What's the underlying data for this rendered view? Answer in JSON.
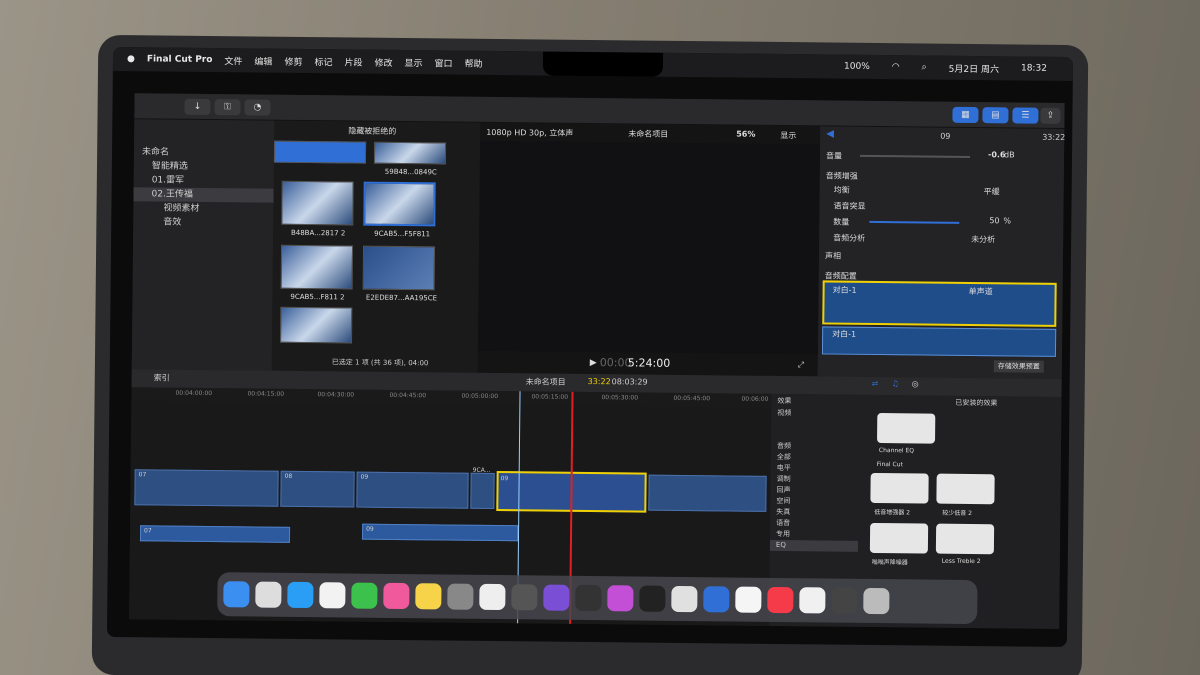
{
  "menubar": {
    "app_name": "Final Cut Pro",
    "menus": [
      "文件",
      "编辑",
      "修剪",
      "标记",
      "片段",
      "修改",
      "显示",
      "窗口",
      "帮助"
    ],
    "battery": "100%",
    "datetime": "5月2日 周六",
    "time": "18:32"
  },
  "sidebar": {
    "library": "未命名",
    "items": [
      "智能精选",
      "01.雷军",
      "02.王传福",
      "视频素材",
      "音效"
    ]
  },
  "browser": {
    "filter": "隐藏被拒绝的",
    "clips": [
      "59B48...0849C",
      "B48BA...2817 2",
      "9CAB5...F5F811",
      "9CAB5...F811 2",
      "E2EDE87...AA195CE"
    ],
    "status": "已选定 1 项 (共 36 项), 04:00"
  },
  "viewer": {
    "format": "1080p HD 30p, 立体声",
    "project": "未命名项目",
    "zoom": "56%",
    "display": "显示",
    "timecode_prefix": "00:00",
    "timecode": "5:24:00"
  },
  "inspector": {
    "clip_name": "09",
    "duration": "33:22",
    "volume_label": "音量",
    "volume_value": "-0.6",
    "volume_unit": "dB",
    "audio_enhance": "音频增强",
    "eq_label": "均衡",
    "eq_value": "平缓",
    "voice_isolation": "语音突显",
    "amount_label": "数量",
    "amount_value": "50",
    "amount_unit": "%",
    "analysis_label": "音频分析",
    "analysis_value": "未分析",
    "pan_label": "声相",
    "config_label": "音频配置",
    "channel1": "对白-1",
    "channel1_mode": "单声道",
    "channel2": "对白-1",
    "save_preset": "存储效果预置"
  },
  "timeline": {
    "index_label": "索引",
    "project": "未命名项目",
    "position": "33:22",
    "total": "08:03:29",
    "ruler": [
      "00:04:00:00",
      "00:04:15:00",
      "00:04:30:00",
      "00:04:45:00",
      "00:05:00:00",
      "00:05:15:00",
      "00:05:30:00",
      "00:05:45:00",
      "00:06:00"
    ],
    "clip_labels": [
      "07",
      "08",
      "09",
      "9CA...",
      "09"
    ],
    "audio_labels": [
      "07",
      "09"
    ]
  },
  "effects": {
    "title": "效果",
    "installed": "已安装的效果",
    "categories": [
      "视频",
      "音频",
      "全部",
      "电平",
      "调制",
      "回声",
      "空间",
      "失真",
      "语音",
      "专用",
      "EQ"
    ],
    "section": "Final Cut",
    "tiles": [
      "Channel EQ",
      "低音增强器 2",
      "较少低音 2",
      "嗡嗡声降噪器",
      "Less Treble 2"
    ]
  },
  "colors": {
    "accent": "#2f6fd6",
    "selection": "#f0d000",
    "playhead": "#e02020"
  }
}
